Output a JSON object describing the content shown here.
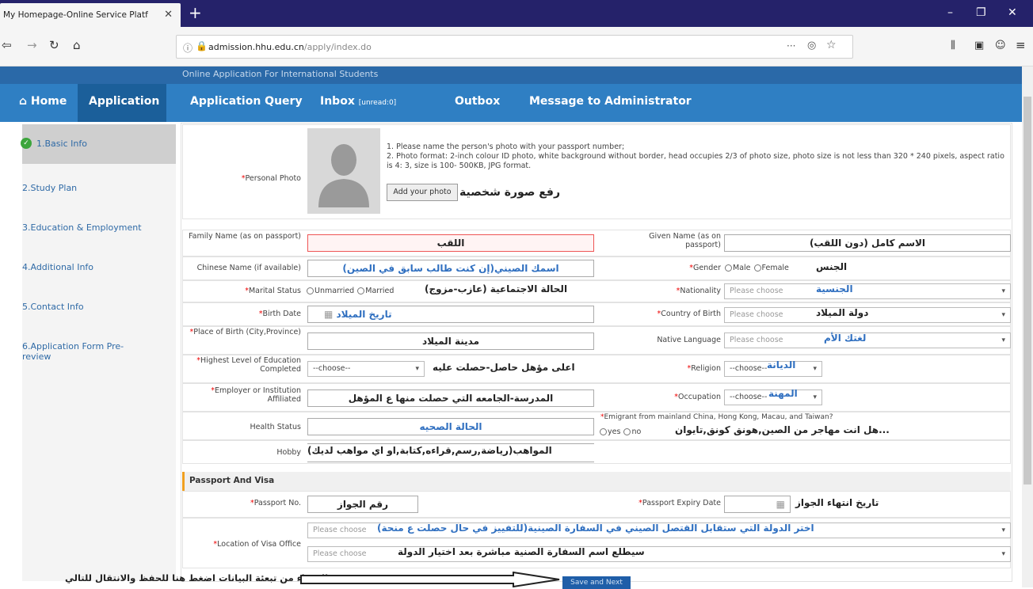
{
  "browser": {
    "tab_title": "My Homepage-Online Service Platf",
    "tab_close": "✕",
    "new_tab": "+",
    "url_host": "admission.hhu.edu.cn",
    "url_path": "/apply/index.do",
    "more": "···",
    "window_min": "–",
    "window_max": "❐",
    "window_close": "✕"
  },
  "site": {
    "title": "Online Application For International Students",
    "menu": {
      "home": "Home",
      "application": "Application",
      "query": "Application Query",
      "inbox": "Inbox",
      "inbox_unread": "[unread:0]",
      "outbox": "Outbox",
      "message": "Message to Administrator"
    }
  },
  "sidebar": {
    "items": [
      {
        "label": "1.Basic Info"
      },
      {
        "label": "2.Study Plan"
      },
      {
        "label": "3.Education & Employment"
      },
      {
        "label": "4.Additional Info"
      },
      {
        "label": "5.Contact Info"
      },
      {
        "label": "6.Application Form Pre-review"
      }
    ]
  },
  "photo": {
    "label": "Personal Photo",
    "instruction1": "1. Please name the person's photo with your passport number;",
    "instruction2": "2. Photo format: 2-inch colour ID photo, white background without border, head occupies 2/3 of photo size, photo size is not less than 320 * 240 pixels, aspect ratio is 4: 3, size is 100- 500KB, JPG format.",
    "button": "Add your photo",
    "note": "رفع صورة شخصية"
  },
  "fields": {
    "family_name_label": "Family Name (as on passport)",
    "family_name_value": "اللقب",
    "given_name_label": "Given Name (as on passport)",
    "given_name_value": "الاسم كامل (دون اللقب)",
    "chinese_name_label": "Chinese Name (if available)",
    "chinese_name_value": "اسمك الصيني(إن كنت طالب سابق في الصين)",
    "gender_label": "Gender",
    "gender_male": "Male",
    "gender_female": "Female",
    "gender_note": "الجنس",
    "marital_label": "Marital Status",
    "marital_unmarried": "Unmarried",
    "marital_married": "Married",
    "marital_note": "الحالة الاجتماعية (عازب-مزوج)",
    "nationality_label": "Nationality",
    "nationality_placeholder": "Please choose",
    "nationality_note": "الجنسية",
    "birth_date_label": "Birth Date",
    "birth_date_value": "تاريخ الميلاد",
    "country_birth_label": "Country of Birth",
    "country_birth_placeholder": "Please choose",
    "country_birth_note": "دولة الميلاد",
    "place_birth_label": "Place of Birth (City,Province)",
    "place_birth_value": "مدينة الميلاد",
    "native_lang_label": "Native Language",
    "native_lang_placeholder": "Please choose",
    "native_lang_note": "لغتك الأم",
    "education_label": "Highest Level of Education Completed",
    "education_select": "--choose--",
    "education_note": "اعلى مؤهل حاصل-حصلت عليه",
    "religion_label": "Religion",
    "religion_select": "--choose--",
    "religion_note": "الديانة",
    "employer_label": "Employer or Institution Affiliated",
    "employer_value": "المدرسة-الجامعه التي حصلت منها ع المؤهل",
    "occupation_label": "Occupation",
    "occupation_select": "--choose--",
    "occupation_note": "المهنة",
    "health_label": "Health Status",
    "health_value": "الحالة الصحيه",
    "emigrant_label": "Emigrant from mainland China, Hong Kong, Macau, and Taiwan?",
    "emigrant_yes": "yes",
    "emigrant_no": "no",
    "emigrant_note": "هل انت مهاجر من الصين,هونق كونق,تايوان...",
    "hobby_label": "Hobby",
    "hobby_value": "المواهب(رياضة,رسم,قراءه,كتابة,او اي مواهب لديك)"
  },
  "passport": {
    "section": "Passport And Visa",
    "no_label": "Passport No.",
    "no_value": "رقم الجواز",
    "expiry_label": "Passport Expiry Date",
    "expiry_note": "تاريخ انتهاء الجواز",
    "visa_label": "Location of Visa Office",
    "visa_placeholder1": "Please choose",
    "visa_note1": "اختر الدولة التي ستقابل القتصل الصيني في السفارة الصينية(للتفييز في حال حصلت ع منحة)",
    "visa_placeholder2": "Please choose",
    "visa_note2": "سيطلع اسم السفارة الصنية مباشرة بعد اختيار الدولة"
  },
  "footer": {
    "save_button": "Save and Next",
    "save_note": "بعد الانتهاء من تبعئة البيانات اضغط هنا للحفظ والانتقال للتالي"
  }
}
